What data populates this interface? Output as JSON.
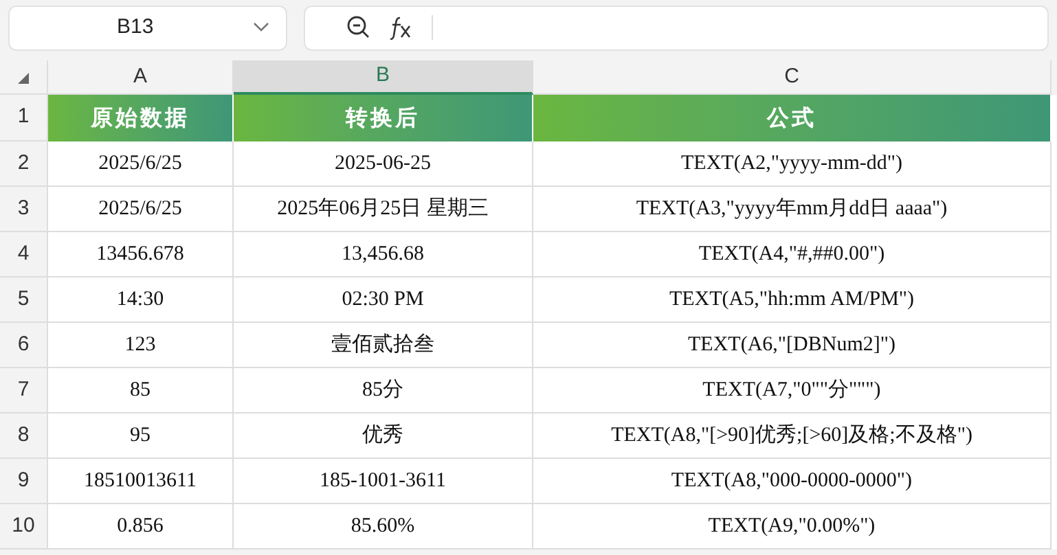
{
  "name_box": {
    "value": "B13"
  },
  "columns": [
    {
      "label": "A",
      "selected": false
    },
    {
      "label": "B",
      "selected": true
    },
    {
      "label": "C",
      "selected": false
    }
  ],
  "header_row": {
    "number": "1",
    "cells": [
      "原始数据",
      "转换后",
      "公式"
    ]
  },
  "rows": [
    {
      "number": "2",
      "cells": [
        "2025/6/25",
        "2025-06-25",
        "TEXT(A2,\"yyyy-mm-dd\")"
      ]
    },
    {
      "number": "3",
      "cells": [
        "2025/6/25",
        "2025年06月25日 星期三",
        "TEXT(A3,\"yyyy年mm月dd日 aaaa\")"
      ]
    },
    {
      "number": "4",
      "cells": [
        "13456.678",
        "13,456.68",
        "TEXT(A4,\"#,##0.00\")"
      ]
    },
    {
      "number": "5",
      "cells": [
        "14:30",
        "02:30 PM",
        "TEXT(A5,\"hh:mm AM/PM\")"
      ]
    },
    {
      "number": "6",
      "cells": [
        "123",
        "壹佰贰拾叁",
        "TEXT(A6,\"[DBNum2]\")"
      ]
    },
    {
      "number": "7",
      "cells": [
        "85",
        "85分",
        "TEXT(A7,\"0\"\"分\"\"\")"
      ]
    },
    {
      "number": "8",
      "cells": [
        "95",
        "优秀",
        "TEXT(A8,\"[>90]优秀;[>60]及格;不及格\")"
      ]
    },
    {
      "number": "9",
      "cells": [
        "18510013611",
        "185-1001-3611",
        "TEXT(A8,\"000-0000-0000\")"
      ]
    },
    {
      "number": "10",
      "cells": [
        "0.856",
        "85.60%",
        "TEXT(A9,\"0.00%\")"
      ]
    }
  ]
}
